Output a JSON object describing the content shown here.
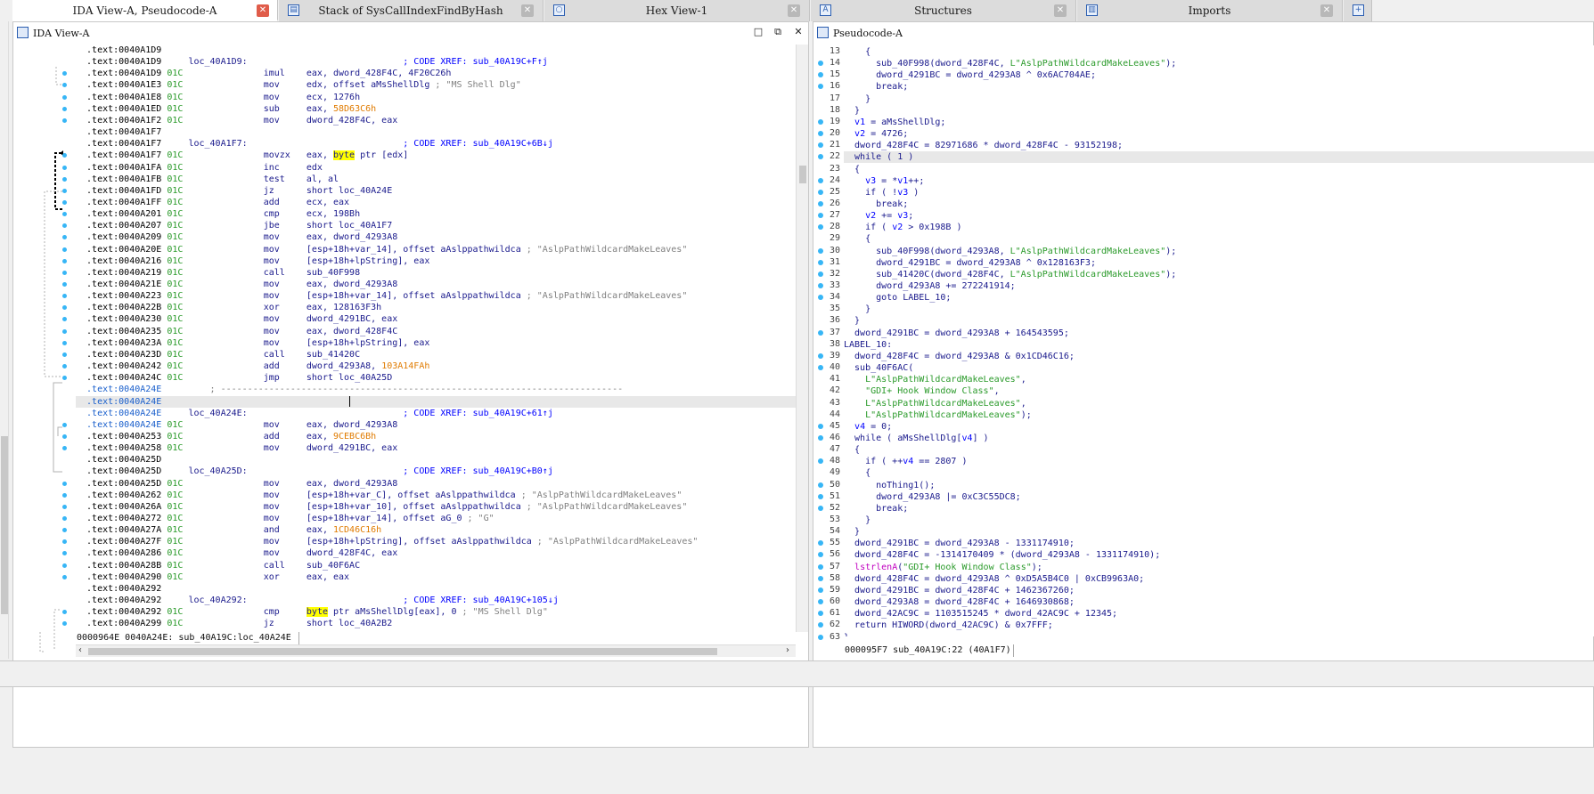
{
  "tabs": {
    "ida_view": "IDA View-A, Pseudocode-A",
    "stack": "Stack of SysCallIndexFindByHash",
    "hex": "Hex View-1",
    "structures": "Structures",
    "imports": "Imports"
  },
  "left_pane": {
    "title": "IDA View-A",
    "status": "0000964E 0040A24E: sub_40A19C:loc_40A24E",
    "lines": [
      {
        "addr": ".text:0040A1D9",
        "sp": "",
        "html": ""
      },
      {
        "addr": ".text:0040A1D9",
        "sp": "",
        "html": "loc_40A1D9:                             <span class='cm'>; CODE XREF: sub_40A19C+F↑j</span>"
      },
      {
        "addr": ".text:0040A1D9",
        "sp": "01C",
        "html": "              imul    eax, dword_428F4C, 4F20C26h"
      },
      {
        "addr": ".text:0040A1E3",
        "sp": "01C",
        "html": "              mov     edx, offset aMsShellDlg <span class='str'>; \"MS Shell Dlg\"</span>"
      },
      {
        "addr": ".text:0040A1E8",
        "sp": "01C",
        "html": "              mov     ecx, 1276h"
      },
      {
        "addr": ".text:0040A1ED",
        "sp": "01C",
        "html": "              sub     eax, <span class='num'>58D63C6h</span>"
      },
      {
        "addr": ".text:0040A1F2",
        "sp": "01C",
        "html": "              mov     dword_428F4C, eax"
      },
      {
        "addr": ".text:0040A1F7",
        "sp": "",
        "html": ""
      },
      {
        "addr": ".text:0040A1F7",
        "sp": "",
        "html": "loc_40A1F7:                             <span class='cm'>; CODE XREF: sub_40A19C+6B↓j</span>"
      },
      {
        "addr": ".text:0040A1F7",
        "sp": "01C",
        "html": "              movzx   eax, <span class='kw'>byte</span> ptr [edx]"
      },
      {
        "addr": ".text:0040A1FA",
        "sp": "01C",
        "html": "              inc     edx"
      },
      {
        "addr": ".text:0040A1FB",
        "sp": "01C",
        "html": "              test    al, al"
      },
      {
        "addr": ".text:0040A1FD",
        "sp": "01C",
        "html": "              jz      short loc_40A24E"
      },
      {
        "addr": ".text:0040A1FF",
        "sp": "01C",
        "html": "              add     ecx, eax"
      },
      {
        "addr": ".text:0040A201",
        "sp": "01C",
        "html": "              cmp     ecx, 198Bh"
      },
      {
        "addr": ".text:0040A207",
        "sp": "01C",
        "html": "              jbe     short loc_40A1F7"
      },
      {
        "addr": ".text:0040A209",
        "sp": "01C",
        "html": "              mov     eax, dword_4293A8"
      },
      {
        "addr": ".text:0040A20E",
        "sp": "01C",
        "html": "              mov     [esp+18h+var_14], offset aAslppathwildca <span class='str'>; \"AslpPathWildcardMakeLeaves\"</span>"
      },
      {
        "addr": ".text:0040A216",
        "sp": "01C",
        "html": "              mov     [esp+18h+lpString], eax"
      },
      {
        "addr": ".text:0040A219",
        "sp": "01C",
        "html": "              call    sub_40F998"
      },
      {
        "addr": ".text:0040A21E",
        "sp": "01C",
        "html": "              mov     eax, dword_4293A8"
      },
      {
        "addr": ".text:0040A223",
        "sp": "01C",
        "html": "              mov     [esp+18h+var_14], offset aAslppathwildca <span class='str'>; \"AslpPathWildcardMakeLeaves\"</span>"
      },
      {
        "addr": ".text:0040A22B",
        "sp": "01C",
        "html": "              xor     eax, 128163F3h"
      },
      {
        "addr": ".text:0040A230",
        "sp": "01C",
        "html": "              mov     dword_4291BC, eax"
      },
      {
        "addr": ".text:0040A235",
        "sp": "01C",
        "html": "              mov     eax, dword_428F4C"
      },
      {
        "addr": ".text:0040A23A",
        "sp": "01C",
        "html": "              mov     [esp+18h+lpString], eax"
      },
      {
        "addr": ".text:0040A23D",
        "sp": "01C",
        "html": "              call    sub_41420C"
      },
      {
        "addr": ".text:0040A242",
        "sp": "01C",
        "html": "              add     dword_4293A8, <span class='num'>103A14FAh</span>"
      },
      {
        "addr": ".text:0040A24C",
        "sp": "01C",
        "html": "              jmp     short loc_40A25D"
      },
      {
        "addr": ".text:0040A24E",
        "sp": "",
        "html": "    <span class='str'>; ---------------------------------------------------------------------------</span>",
        "blue": true
      },
      {
        "addr": ".text:0040A24E",
        "sp": "",
        "html": "",
        "blue": true,
        "hl": true
      },
      {
        "addr": ".text:0040A24E",
        "sp": "",
        "html": "loc_40A24E:                             <span class='cm'>; CODE XREF: sub_40A19C+61↑j</span>",
        "blue": true
      },
      {
        "addr": ".text:0040A24E",
        "sp": "01C",
        "html": "              mov     eax, dword_4293A8",
        "blue": true
      },
      {
        "addr": ".text:0040A253",
        "sp": "01C",
        "html": "              add     eax, <span class='num'>9CEBC6Bh</span>"
      },
      {
        "addr": ".text:0040A258",
        "sp": "01C",
        "html": "              mov     dword_4291BC, eax"
      },
      {
        "addr": ".text:0040A25D",
        "sp": "",
        "html": ""
      },
      {
        "addr": ".text:0040A25D",
        "sp": "",
        "html": "loc_40A25D:                             <span class='cm'>; CODE XREF: sub_40A19C+B0↑j</span>"
      },
      {
        "addr": ".text:0040A25D",
        "sp": "01C",
        "html": "              mov     eax, dword_4293A8"
      },
      {
        "addr": ".text:0040A262",
        "sp": "01C",
        "html": "              mov     [esp+18h+var_C], offset aAslppathwildca <span class='str'>; \"AslpPathWildcardMakeLeaves\"</span>"
      },
      {
        "addr": ".text:0040A26A",
        "sp": "01C",
        "html": "              mov     [esp+18h+var_10], offset aAslppathwildca <span class='str'>; \"AslpPathWildcardMakeLeaves\"</span>"
      },
      {
        "addr": ".text:0040A272",
        "sp": "01C",
        "html": "              mov     [esp+18h+var_14], offset aG_0 <span class='str'>; \"G\"</span>"
      },
      {
        "addr": ".text:0040A27A",
        "sp": "01C",
        "html": "              and     eax, <span class='num'>1CD46C16h</span>"
      },
      {
        "addr": ".text:0040A27F",
        "sp": "01C",
        "html": "              mov     [esp+18h+lpString], offset aAslppathwildca <span class='str'>; \"AslpPathWildcardMakeLeaves\"</span>"
      },
      {
        "addr": ".text:0040A286",
        "sp": "01C",
        "html": "              mov     dword_428F4C, eax"
      },
      {
        "addr": ".text:0040A28B",
        "sp": "01C",
        "html": "              call    sub_40F6AC"
      },
      {
        "addr": ".text:0040A290",
        "sp": "01C",
        "html": "              xor     eax, eax"
      },
      {
        "addr": ".text:0040A292",
        "sp": "",
        "html": ""
      },
      {
        "addr": ".text:0040A292",
        "sp": "",
        "html": "loc_40A292:                             <span class='cm'>; CODE XREF: sub_40A19C+105↓j</span>"
      },
      {
        "addr": ".text:0040A292",
        "sp": "01C",
        "html": "              cmp     <span class='kw'>byte</span> ptr aMsShellDlg[eax], 0 <span class='str'>; \"MS Shell Dlg\"</span>"
      },
      {
        "addr": ".text:0040A299",
        "sp": "01C",
        "html": "              jz      short loc_40A2B2"
      }
    ]
  },
  "right_pane": {
    "title": "Pseudocode-A",
    "status": "000095F7 sub_40A19C:22 (40A1F7)",
    "lines": [
      {
        "n": "13",
        "bp": false,
        "html": "    {"
      },
      {
        "n": "14",
        "bp": true,
        "html": "      sub_40F998(dword_428F4C, <span class='sp'>L\"AslpPathWildcardMakeLeaves\"</span>);"
      },
      {
        "n": "15",
        "bp": true,
        "html": "      dword_4291BC = dword_4293A8 ^ 0x6AC704AE;"
      },
      {
        "n": "16",
        "bp": true,
        "html": "      break;"
      },
      {
        "n": "17",
        "bp": false,
        "html": "    }"
      },
      {
        "n": "18",
        "bp": false,
        "html": "  }"
      },
      {
        "n": "19",
        "bp": true,
        "html": "  <span class='cm'>v1</span> = aMsShellDlg;"
      },
      {
        "n": "20",
        "bp": true,
        "html": "  <span class='cm'>v2</span> = 4726;"
      },
      {
        "n": "21",
        "bp": true,
        "html": "  dword_428F4C = 82971686 * dword_428F4C - 93152198;"
      },
      {
        "n": "22",
        "bp": true,
        "html": "  while ( 1 )",
        "hl": true
      },
      {
        "n": "23",
        "bp": false,
        "html": "  {"
      },
      {
        "n": "24",
        "bp": true,
        "html": "    <span class='cm'>v3</span> = *<span class='cm'>v1</span>++;"
      },
      {
        "n": "25",
        "bp": true,
        "html": "    if ( !<span class='cm'>v3</span> )"
      },
      {
        "n": "26",
        "bp": true,
        "html": "      break;"
      },
      {
        "n": "27",
        "bp": true,
        "html": "    <span class='cm'>v2</span> += <span class='cm'>v3</span>;"
      },
      {
        "n": "28",
        "bp": true,
        "html": "    if ( <span class='cm'>v2</span> > 0x198B )"
      },
      {
        "n": "29",
        "bp": false,
        "html": "    {"
      },
      {
        "n": "30",
        "bp": true,
        "html": "      sub_40F998(dword_4293A8, <span class='sp'>L\"AslpPathWildcardMakeLeaves\"</span>);"
      },
      {
        "n": "31",
        "bp": true,
        "html": "      dword_4291BC = dword_4293A8 ^ 0x128163F3;"
      },
      {
        "n": "32",
        "bp": true,
        "html": "      sub_41420C(dword_428F4C, <span class='sp'>L\"AslpPathWildcardMakeLeaves\"</span>);"
      },
      {
        "n": "33",
        "bp": true,
        "html": "      dword_4293A8 += 272241914;"
      },
      {
        "n": "34",
        "bp": true,
        "html": "      goto LABEL_10;"
      },
      {
        "n": "35",
        "bp": false,
        "html": "    }"
      },
      {
        "n": "36",
        "bp": false,
        "html": "  }"
      },
      {
        "n": "37",
        "bp": true,
        "html": "  dword_4291BC = dword_4293A8 + 164543595;"
      },
      {
        "n": "38",
        "bp": false,
        "html": "LABEL_10:"
      },
      {
        "n": "39",
        "bp": true,
        "html": "  dword_428F4C = dword_4293A8 &amp; 0x1CD46C16;"
      },
      {
        "n": "40",
        "bp": true,
        "html": "  sub_40F6AC("
      },
      {
        "n": "41",
        "bp": false,
        "html": "    <span class='sp'>L\"AslpPathWildcardMakeLeaves\"</span>,"
      },
      {
        "n": "42",
        "bp": false,
        "html": "    <span class='sp'>\"GDI+ Hook Window Class\"</span>,"
      },
      {
        "n": "43",
        "bp": false,
        "html": "    <span class='sp'>L\"AslpPathWildcardMakeLeaves\"</span>,"
      },
      {
        "n": "44",
        "bp": false,
        "html": "    <span class='sp'>L\"AslpPathWildcardMakeLeaves\"</span>);"
      },
      {
        "n": "45",
        "bp": true,
        "html": "  <span class='cm'>v4</span> = 0;"
      },
      {
        "n": "46",
        "bp": true,
        "html": "  while ( aMsShellDlg[<span class='cm'>v4</span>] )"
      },
      {
        "n": "47",
        "bp": false,
        "html": "  {"
      },
      {
        "n": "48",
        "bp": true,
        "html": "    if ( ++<span class='cm'>v4</span> == 2807 )"
      },
      {
        "n": "49",
        "bp": false,
        "html": "    {"
      },
      {
        "n": "50",
        "bp": true,
        "html": "      noThing1();"
      },
      {
        "n": "51",
        "bp": true,
        "html": "      dword_4293A8 |= 0xC3C55DC8;"
      },
      {
        "n": "52",
        "bp": true,
        "html": "      break;"
      },
      {
        "n": "53",
        "bp": false,
        "html": "    }"
      },
      {
        "n": "54",
        "bp": false,
        "html": "  }"
      },
      {
        "n": "55",
        "bp": true,
        "html": "  dword_4291BC = dword_4293A8 - 1331174910;"
      },
      {
        "n": "56",
        "bp": true,
        "html": "  dword_428F4C = -1314170409 * (dword_4293A8 - 1331174910);"
      },
      {
        "n": "57",
        "bp": true,
        "html": "  <span class='fn'>lstrlenA</span>(<span class='sp'>\"GDI+ Hook Window Class\"</span>);"
      },
      {
        "n": "58",
        "bp": true,
        "html": "  dword_428F4C = dword_4293A8 ^ 0xD5A5B4C0 | 0xCB9963A0;"
      },
      {
        "n": "59",
        "bp": true,
        "html": "  dword_4291BC = dword_428F4C + 1462367260;"
      },
      {
        "n": "60",
        "bp": true,
        "html": "  dword_4293A8 = dword_428F4C + 1646930868;"
      },
      {
        "n": "61",
        "bp": true,
        "html": "  dword_42AC9C = 1103515245 * dword_42AC9C + 12345;"
      },
      {
        "n": "62",
        "bp": true,
        "html": "  return HIWORD(dword_42AC9C) &amp; 0x7FFF;"
      },
      {
        "n": "63",
        "bp": true,
        "html": "}"
      }
    ]
  }
}
